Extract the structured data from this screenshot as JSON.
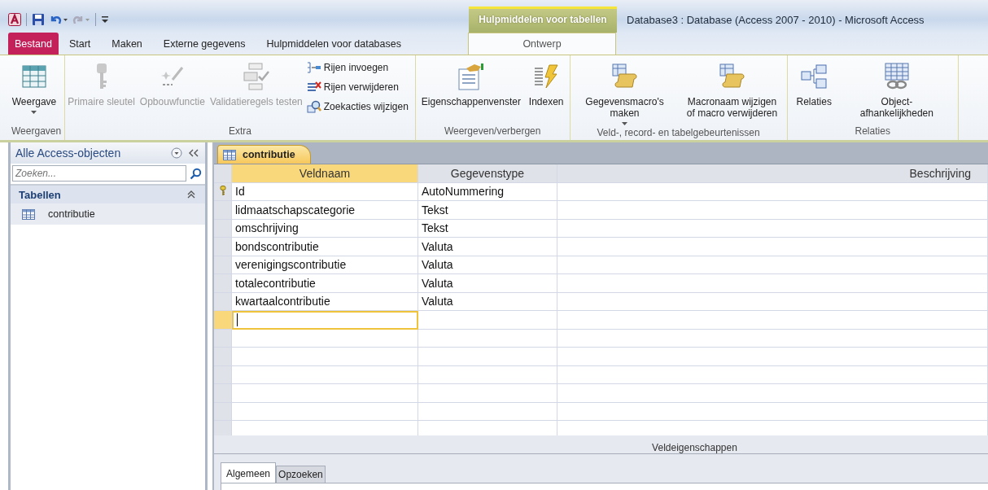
{
  "window": {
    "title": "Database3 : Database (Access 2007 - 2010)  -  Microsoft Access",
    "context_header": "Hulpmiddelen voor tabellen"
  },
  "tabs": [
    {
      "label": "Bestand",
      "kind": "file",
      "selected": false
    },
    {
      "label": "Start",
      "kind": "normal",
      "selected": false
    },
    {
      "label": "Maken",
      "kind": "normal",
      "selected": false
    },
    {
      "label": "Externe gegevens",
      "kind": "normal",
      "selected": false
    },
    {
      "label": "Hulpmiddelen voor databases",
      "kind": "normal",
      "selected": false
    },
    {
      "label": "Ontwerp",
      "kind": "context",
      "selected": true
    }
  ],
  "ribbon": {
    "groups": [
      {
        "label": "Weergaven",
        "buttons": [
          {
            "kind": "large",
            "label": "Weergave",
            "menu": true,
            "disabled": false
          }
        ]
      },
      {
        "label": "Extra",
        "buttons": [
          {
            "kind": "large",
            "label": "Primaire sleutel",
            "menu": false,
            "disabled": true
          },
          {
            "kind": "large",
            "label": "Opbouwfunctie",
            "menu": false,
            "disabled": true
          },
          {
            "kind": "large",
            "label": "Validatieregels testen",
            "menu": false,
            "disabled": true
          },
          {
            "kind": "stack",
            "items": [
              {
                "label": "Rijen invoegen",
                "disabled": false
              },
              {
                "label": "Rijen verwijderen",
                "disabled": false
              },
              {
                "label": "Zoekacties wijzigen",
                "disabled": false
              }
            ]
          }
        ]
      },
      {
        "label": "Weergeven/verbergen",
        "buttons": [
          {
            "kind": "large",
            "label": "Eigenschappenvenster",
            "menu": false,
            "disabled": false
          },
          {
            "kind": "large",
            "label": "Indexen",
            "menu": false,
            "disabled": false
          }
        ]
      },
      {
        "label": "Veld-, record- en tabelgebeurtenissen",
        "buttons": [
          {
            "kind": "large",
            "label": "Gegevensmacro's maken",
            "menu": true,
            "disabled": false
          },
          {
            "kind": "large",
            "label": "Macronaam wijzigen of macro verwijderen",
            "menu": false,
            "disabled": false
          }
        ]
      },
      {
        "label": "Relaties",
        "buttons": [
          {
            "kind": "large",
            "label": "Relaties",
            "menu": false,
            "disabled": false
          },
          {
            "kind": "large",
            "label": "Object-afhankelijkheden",
            "menu": false,
            "disabled": false
          }
        ]
      }
    ]
  },
  "navigation": {
    "title": "Alle Access-objecten",
    "search": {
      "placeholder": "Zoeken..."
    },
    "groups": [
      {
        "label": "Tabellen",
        "expanded": true,
        "items": [
          {
            "label": "contributie",
            "selected": false
          }
        ]
      }
    ]
  },
  "document": {
    "tab": "contributie",
    "columns": [
      "Veldnaam",
      "Gegevenstype",
      "Beschrijving"
    ],
    "rows": [
      {
        "field": "Id",
        "type": "AutoNummering",
        "description": "",
        "primary_key": true,
        "selected": false
      },
      {
        "field": "lidmaatschapscategorie",
        "type": "Tekst",
        "primary_key": false,
        "selected": false
      },
      {
        "field": "omschrijving",
        "type": "Tekst",
        "primary_key": false,
        "selected": false
      },
      {
        "field": "bondscontributie",
        "type": "Valuta",
        "primary_key": false,
        "selected": false
      },
      {
        "field": "verenigingscontributie",
        "type": "Valuta",
        "primary_key": false,
        "selected": false
      },
      {
        "field": "totalecontributie",
        "type": "Valuta",
        "primary_key": false,
        "selected": false
      },
      {
        "field": "kwartaalcontributie",
        "type": "Valuta",
        "primary_key": false,
        "selected": false
      },
      {
        "field": "",
        "type": "",
        "primary_key": false,
        "selected": true
      }
    ],
    "properties": {
      "label": "Veldeigenschappen",
      "tabs": [
        {
          "label": "Algemeen",
          "selected": true
        },
        {
          "label": "Opzoeken",
          "selected": false
        }
      ]
    }
  }
}
